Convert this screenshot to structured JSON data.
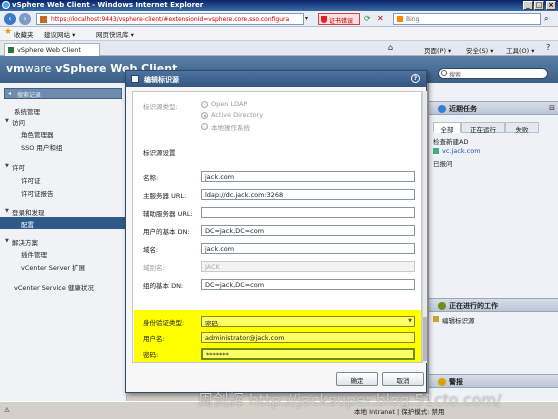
{
  "browser": {
    "window_title": "vSphere Web Client - Windows Internet Explorer",
    "url": "https://localhost:9443/vsphere-client/#extensionId=vsphere.core.sso.configura",
    "cert_error": "证书错误",
    "search_placeholder": "Bing",
    "favorites_label": "收藏夹",
    "favbar_items": [
      "建议网站 ▾",
      "网页快讯库 ▾"
    ],
    "tab_title": "vSphere Web Client",
    "command_bar": [
      "页面(P) ▾",
      "安全(S) ▾",
      "工具(O) ▾"
    ],
    "status_text": "本地 Intranet | 保护模式: 禁用"
  },
  "vsphere": {
    "brand_prefix": "vm",
    "brand_suffix": "ware",
    "brand_title": "vSphere Web Client",
    "header_search_placeholder": "搜索",
    "nav_search_placeholder": "搜索记录",
    "nav": {
      "system_mgmt": "系统管理",
      "access": "访问",
      "roles": "角色管理器",
      "sso_users": "SSO 用户和组",
      "license": "许可",
      "licenses": "许可证",
      "license_report": "许可证报告",
      "sso": "登录和发现",
      "config": "配置",
      "solutions": "解决方案",
      "plugins": "插件管理",
      "vcenter_ext": "vCenter Server 扩展",
      "health": "vCenter Service 健康状况"
    },
    "recent_tasks": {
      "title": "近期任务",
      "tabs": [
        "全部",
        "正在运行",
        "失败"
      ],
      "rows": [
        "检查新建AD",
        "vc.jack.com",
        "已报问"
      ]
    },
    "work_in_progress": {
      "title": "正在进行的工作",
      "rows": [
        "编辑标识源"
      ]
    },
    "alarms": {
      "title": "警报"
    }
  },
  "dialog": {
    "title": "编辑标识源",
    "identity_source_type_label": "标识源类型:",
    "radio_options": [
      {
        "label": "Open LDAP",
        "checked": false
      },
      {
        "label": "Active Directory",
        "checked": true
      },
      {
        "label": "本地操作系统",
        "checked": false
      }
    ],
    "settings_heading": "标识源设置",
    "fields": [
      {
        "label": "名称:",
        "value": "jack.com"
      },
      {
        "label": "主服务器 URL:",
        "value": "ldap://dc.jack.com:3268"
      },
      {
        "label": "辅助服务器 URL:",
        "value": ""
      },
      {
        "label": "用户的基本 DN:",
        "value": "DC=jack,DC=com"
      },
      {
        "label": "域名:",
        "value": "jack.com"
      },
      {
        "label": "域别名:",
        "value": "JACK",
        "disabled": true
      },
      {
        "label": "组的基本 DN:",
        "value": "DC=jack,DC=com"
      }
    ],
    "auth_type_label": "身份验证类型:",
    "auth_type_value": "密码",
    "username_label": "用户名:",
    "username_value": "administrator@jack.com",
    "password_label": "密码:",
    "password_value": "*******",
    "ok_label": "确定",
    "cancel_label": "取消",
    "highlight_color": "#ffff00"
  },
  "watermark": "周剑辉 http://jacksuper.blog.51cto.com/"
}
